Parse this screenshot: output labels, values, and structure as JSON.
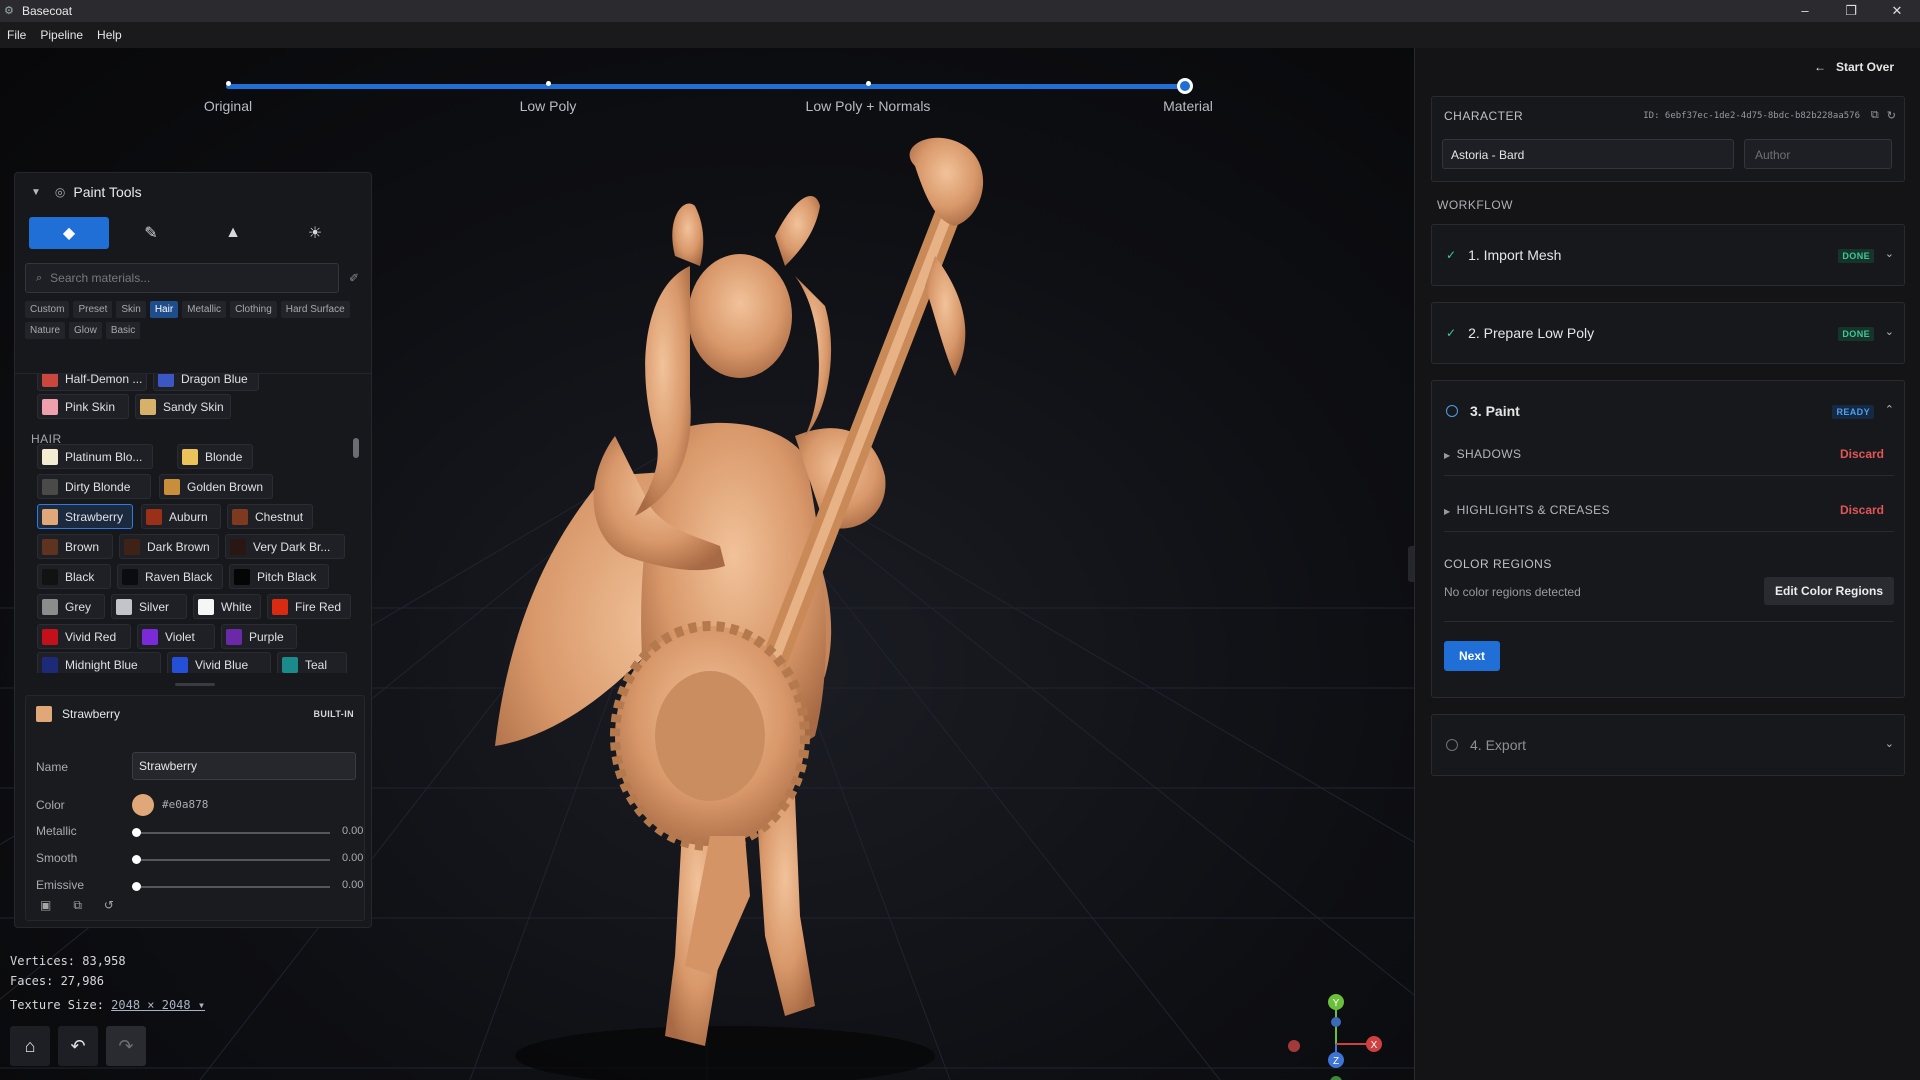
{
  "window": {
    "title": "Basecoat",
    "controls": [
      "–",
      "❐",
      "✕"
    ]
  },
  "menu": [
    "File",
    "Pipeline",
    "Help"
  ],
  "pipeline": {
    "steps": [
      "Original",
      "Low Poly",
      "Low Poly + Normals",
      "Material"
    ],
    "current": "Material"
  },
  "paint_tools": {
    "title": "Paint Tools",
    "tools": [
      "fill-bucket-icon",
      "brush-icon",
      "stamp-icon",
      "light-icon"
    ],
    "search_placeholder": "Search materials...",
    "categories": [
      "Custom",
      "Preset",
      "Skin",
      "Hair",
      "Metallic",
      "Clothing",
      "Hard Surface",
      "Nature",
      "Glow",
      "Basic"
    ],
    "active_category": "Hair",
    "skin_partial": [
      {
        "name": "Half-Demon ...",
        "color": "#c9473f"
      },
      {
        "name": "Dragon Blue",
        "color": "#3b57c4"
      },
      {
        "name": "Pink Skin",
        "color": "#f0a0ad"
      },
      {
        "name": "Sandy Skin",
        "color": "#d7b06a"
      }
    ],
    "hair_label": "HAIR",
    "hair": [
      {
        "name": "Platinum Blo...",
        "color": "#f4ecd2"
      },
      {
        "name": "Blonde",
        "color": "#ecc35a"
      },
      {
        "name": "Dirty Blonde",
        "color": "#4a4a48"
      },
      {
        "name": "Golden Brown",
        "color": "#c88e3a"
      },
      {
        "name": "Strawberry",
        "color": "#e0a878"
      },
      {
        "name": "Auburn",
        "color": "#9a3018"
      },
      {
        "name": "Chestnut",
        "color": "#7d3a1e"
      },
      {
        "name": "Brown",
        "color": "#5e3420"
      },
      {
        "name": "Dark Brown",
        "color": "#3e2218"
      },
      {
        "name": "Very Dark Br...",
        "color": "#2a1612"
      },
      {
        "name": "Black",
        "color": "#121212"
      },
      {
        "name": "Raven Black",
        "color": "#0c0c10"
      },
      {
        "name": "Pitch Black",
        "color": "#050505"
      },
      {
        "name": "Grey",
        "color": "#8c8c8c"
      },
      {
        "name": "Silver",
        "color": "#c4c4c8"
      },
      {
        "name": "White",
        "color": "#f6f6f6"
      },
      {
        "name": "Fire Red",
        "color": "#d92b12"
      },
      {
        "name": "Vivid Red",
        "color": "#c3101a"
      },
      {
        "name": "Violet",
        "color": "#7a2ad6"
      },
      {
        "name": "Purple",
        "color": "#6a2aa8"
      },
      {
        "name": "Midnight Blue",
        "color": "#1c2a78"
      },
      {
        "name": "Vivid Blue",
        "color": "#2450d8"
      },
      {
        "name": "Teal",
        "color": "#1a8a8a"
      }
    ],
    "selected": {
      "name": "Strawberry",
      "badge": "BUILT-IN",
      "name_label": "Name",
      "color_label": "Color",
      "color": "#e0a878",
      "hex": "#e0a878",
      "metallic_label": "Metallic",
      "metallic": "0.00",
      "smooth_label": "Smooth",
      "smooth": "0.00",
      "emissive_label": "Emissive",
      "emissive": "0.00"
    }
  },
  "stats": {
    "vertices": "Vertices: 83,958",
    "faces": "Faces: 27,986",
    "texture_label": "Texture Size:",
    "texture_value": "2048 × 2048 ▾"
  },
  "gizmo": {
    "x": "X",
    "y": "Y",
    "z": "Z"
  },
  "right_panel": {
    "start_over": "Start Over",
    "character": {
      "label": "CHARACTER",
      "id": "ID: 6ebf37ec-1de2-4d75-8bdc-b82b228aa576",
      "name": "Astoria - Bard",
      "author_placeholder": "Author"
    },
    "workflow_label": "WORKFLOW",
    "steps": [
      {
        "title": "1. Import Mesh",
        "status": "DONE"
      },
      {
        "title": "2. Prepare Low Poly",
        "status": "DONE"
      },
      {
        "title": "3. Paint",
        "status": "READY"
      },
      {
        "title": "4. Export",
        "status": ""
      }
    ],
    "paint": {
      "shadows": "SHADOWS",
      "highlights": "HIGHLIGHTS & CREASES",
      "discard": "Discard",
      "color_regions_label": "COLOR REGIONS",
      "color_regions_empty": "No color regions detected",
      "edit_color_regions": "Edit Color Regions",
      "next": "Next"
    }
  }
}
